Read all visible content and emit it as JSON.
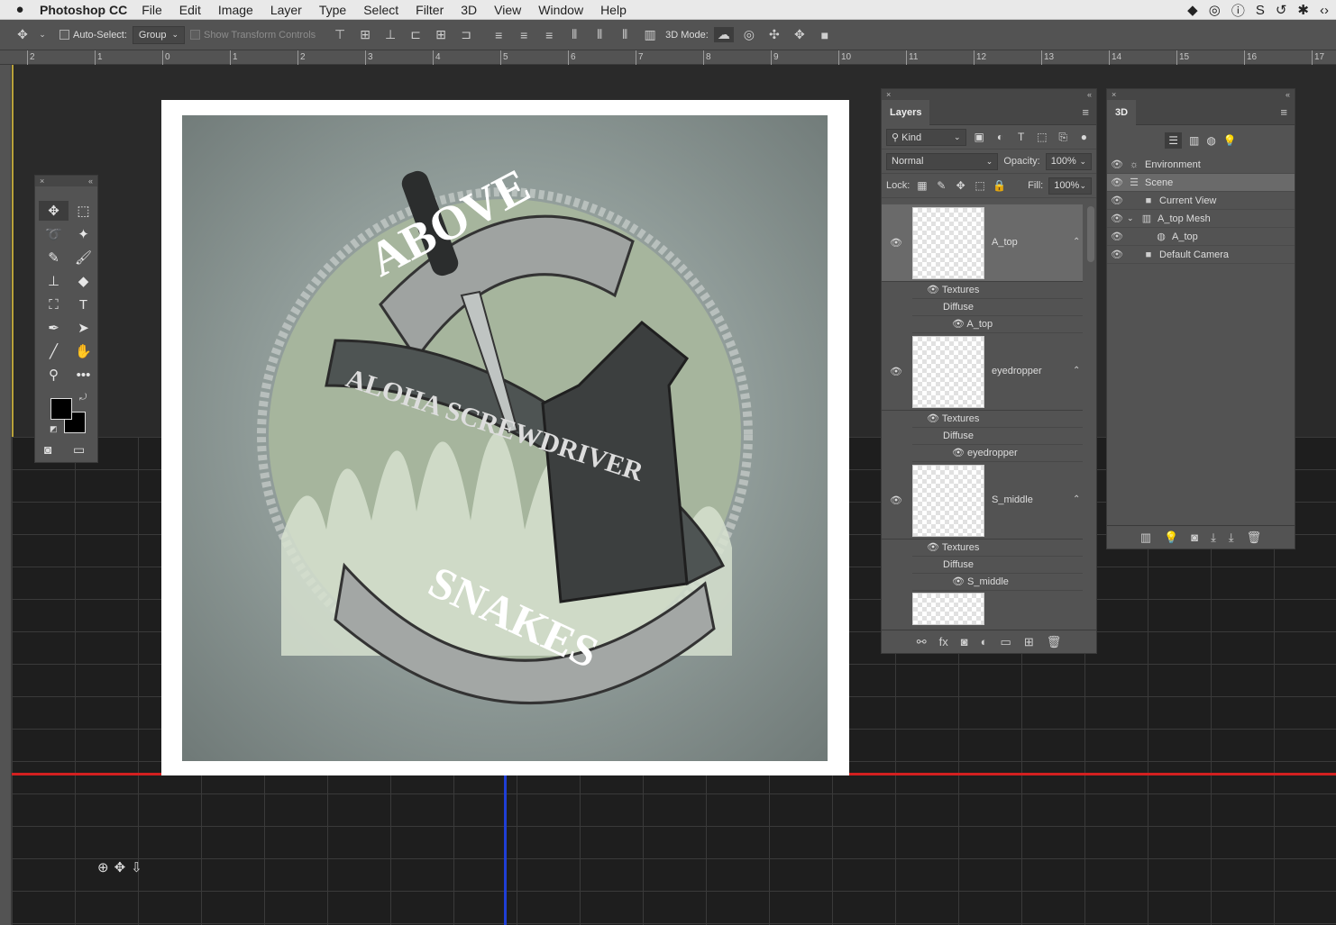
{
  "menubar": {
    "app_name": "Photoshop CC",
    "items": [
      "File",
      "Edit",
      "Image",
      "Layer",
      "Type",
      "Select",
      "Filter",
      "3D",
      "View",
      "Window",
      "Help"
    ]
  },
  "options": {
    "auto_select_label": "Auto-Select:",
    "auto_select_value": "Group",
    "show_transform_label": "Show Transform Controls",
    "mode_label": "3D Mode:"
  },
  "ruler": {
    "ticks": [
      "2",
      "1",
      "0",
      "1",
      "2",
      "3",
      "4",
      "5",
      "6",
      "7",
      "8",
      "9",
      "10",
      "11",
      "12",
      "13",
      "14",
      "15",
      "16",
      "17"
    ]
  },
  "layers_panel": {
    "tab": "Layers",
    "filter_value": "Kind",
    "blend_mode": "Normal",
    "opacity_label": "Opacity:",
    "opacity_value": "100%",
    "lock_label": "Lock:",
    "fill_label": "Fill:",
    "fill_value": "100%",
    "layers": [
      {
        "name": "A_top",
        "textures": "Textures",
        "diffuse": "Diffuse",
        "texture_name": "A_top"
      },
      {
        "name": "eyedropper",
        "textures": "Textures",
        "diffuse": "Diffuse",
        "texture_name": "eyedropper"
      },
      {
        "name": "S_middle",
        "textures": "Textures",
        "diffuse": "Diffuse",
        "texture_name": "S_middle"
      }
    ]
  },
  "panel_3d": {
    "tab": "3D",
    "scene": [
      "Environment",
      "Scene",
      "Current View",
      "A_top Mesh",
      "A_top",
      "Default Camera"
    ]
  },
  "artwork": {
    "banner_top": "ABOVE",
    "banner_mid": "ALOHA SCREWDRIVER",
    "banner_bottom": "SNAKES"
  }
}
